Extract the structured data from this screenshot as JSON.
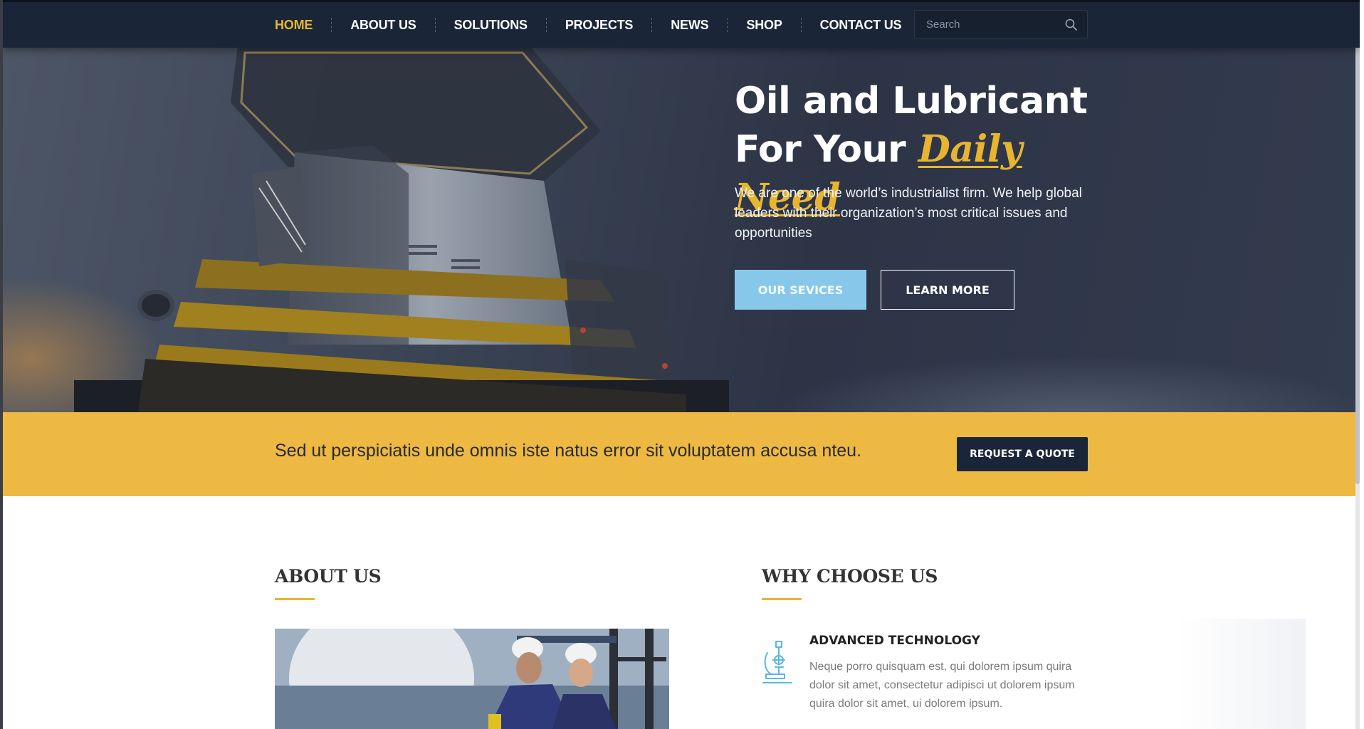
{
  "nav": {
    "items": [
      {
        "label": "HOME",
        "active": true
      },
      {
        "label": "ABOUT US",
        "active": false
      },
      {
        "label": "SOLUTIONS",
        "active": false
      },
      {
        "label": "PROJECTS",
        "active": false
      },
      {
        "label": "NEWS",
        "active": false
      },
      {
        "label": "SHOP",
        "active": false
      },
      {
        "label": "CONTACT US",
        "active": false
      }
    ]
  },
  "search": {
    "placeholder": "Search",
    "icon": "search-icon"
  },
  "hero": {
    "title_line1": "Oil and Lubricant",
    "title_line2_prefix": "For Your ",
    "title_accent": "Daily Need",
    "text": "We are one of the world’s industrialist firm. We help global leaders with their organization’s most critical issues and opportunities",
    "primary_button": "OUR SEVICES",
    "secondary_button": "LEARN MORE"
  },
  "quote_band": {
    "text": "Sed ut perspiciatis unde omnis iste natus error sit voluptatem accusa nteu.",
    "button": "REQUEST A QUOTE"
  },
  "about": {
    "title": "ABOUT US"
  },
  "why": {
    "title": "WHY CHOOSE US",
    "features": [
      {
        "icon": "microscope-icon",
        "title": "ADVANCED TECHNOLOGY",
        "text": "Neque porro quisquam est, qui dolorem ipsum quira dolor sit amet, consectetur adipisci ut dolorem ipsum quira dolor sit amet, ui dolorem ipsum."
      }
    ]
  },
  "colors": {
    "accent": "#e8b531",
    "navy": "#1a2538",
    "sky_button": "#87c8ea",
    "band": "#edb943"
  }
}
